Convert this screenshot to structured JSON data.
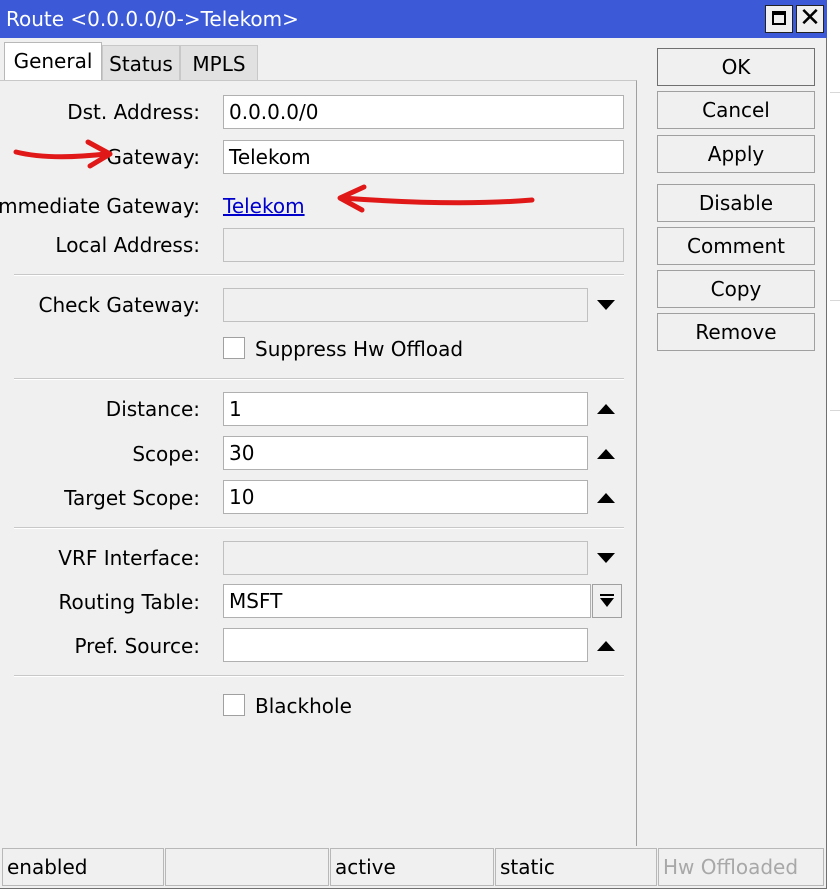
{
  "window": {
    "title": "Route <0.0.0.0/0->Telekom>",
    "icons": {
      "maximize": "maximize-icon",
      "close": "close-icon"
    },
    "close_glyph": "✕"
  },
  "tabs": [
    {
      "label": "General",
      "active": true
    },
    {
      "label": "Status",
      "active": false
    },
    {
      "label": "MPLS",
      "active": false
    }
  ],
  "form": {
    "dst_address": {
      "label": "Dst. Address:",
      "value": "0.0.0.0/0"
    },
    "gateway": {
      "label": "Gateway:",
      "value": "Telekom"
    },
    "immediate_gateway": {
      "label": "Immediate Gateway:",
      "value": "Telekom"
    },
    "local_address": {
      "label": "Local Address:",
      "value": ""
    },
    "check_gateway": {
      "label": "Check Gateway:",
      "value": ""
    },
    "suppress_hw_offload": {
      "label": "Suppress Hw Offload",
      "checked": false
    },
    "distance": {
      "label": "Distance:",
      "value": "1"
    },
    "scope": {
      "label": "Scope:",
      "value": "30"
    },
    "target_scope": {
      "label": "Target Scope:",
      "value": "10"
    },
    "vrf_interface": {
      "label": "VRF Interface:",
      "value": ""
    },
    "routing_table": {
      "label": "Routing Table:",
      "value": "MSFT"
    },
    "pref_source": {
      "label": "Pref. Source:",
      "value": ""
    },
    "blackhole": {
      "label": "Blackhole",
      "checked": false
    }
  },
  "buttons": {
    "ok": "OK",
    "cancel": "Cancel",
    "apply": "Apply",
    "disable": "Disable",
    "comment": "Comment",
    "copy": "Copy",
    "remove": "Remove"
  },
  "statusbar": [
    {
      "text": "enabled",
      "dim": false
    },
    {
      "text": "",
      "dim": false
    },
    {
      "text": "active",
      "dim": false
    },
    {
      "text": "static",
      "dim": false
    },
    {
      "text": "Hw Offloaded",
      "dim": true
    }
  ],
  "colors": {
    "titlebar": "#3c5ad8",
    "link": "#0000cc",
    "annotation": "#e01818"
  }
}
